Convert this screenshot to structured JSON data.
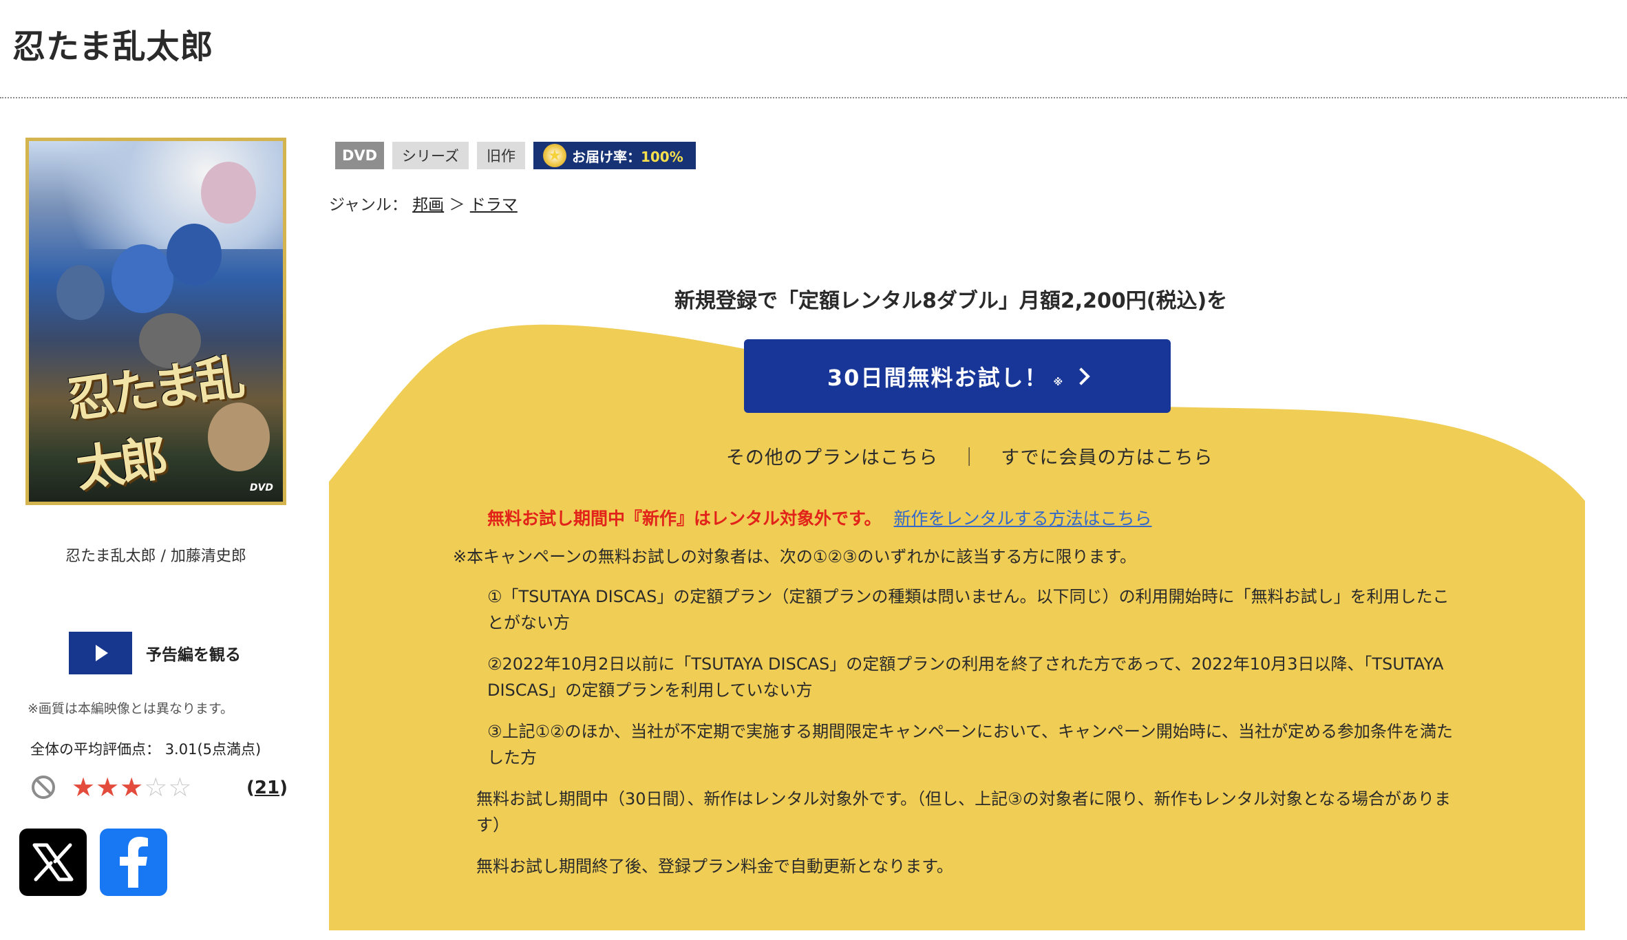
{
  "title": "忍たま乱太郎",
  "product": {
    "caption": "忍たま乱太郎 / 加藤清史郎",
    "cover_logo": "忍たま乱太郎",
    "cover_dvd": "DVD"
  },
  "trailer": {
    "label": "予告編を観る",
    "note": "※画質は本編映像とは異なります。"
  },
  "rating": {
    "label": "全体の平均評価点：",
    "value": "3.01(5点満点)",
    "stars": 3,
    "max_stars": 5,
    "count_open": "(",
    "count": "21",
    "count_close": ")"
  },
  "social": {
    "x_icon": "x-logo-icon",
    "facebook_icon": "facebook-logo-icon"
  },
  "tags": {
    "format": "DVD",
    "series": "シリーズ",
    "old": "旧作",
    "delivery_label": "お届け率：",
    "delivery_value": "100%"
  },
  "genre": {
    "label": "ジャンル：",
    "parent": "邦画",
    "separator": "＞",
    "child": "ドラマ"
  },
  "campaign": {
    "heading": "新規登録で「定額レンタル8ダブル」月額2,200円(税込)を",
    "cta_label": "30日間無料お試し！",
    "cta_mark": "※",
    "other_plans": "その他のプランはこちら",
    "separator": "｜",
    "members": "すでに会員の方はこちら",
    "warning": "無料お試し期間中『新作』はレンタル対象外です。",
    "warning_link": "新作をレンタルする方法はこちら",
    "intro": "※本キャンペーンの無料お試しの対象者は、次の①②③のいずれかに該当する方に限ります。",
    "condition_1": "①「TSUTAYA DISCAS」の定額プラン（定額プランの種類は問いません。以下同じ）の利用開始時に「無料お試し」を利用したことがない方",
    "condition_2": "②2022年10月2日以前に「TSUTAYA DISCAS」の定額プランの利用を終了された方であって、2022年10月3日以降、「TSUTAYA DISCAS」の定額プランを利用していない方",
    "condition_3": "③上記①②のほか、当社が不定期で実施する期間限定キャンペーンにおいて、キャンペーン開始時に、当社が定める参加条件を満たした方",
    "note_1": "無料お試し期間中（30日間）、新作はレンタル対象外です。（但し、上記③の対象者に限り、新作もレンタル対象となる場合があります）",
    "note_2": "無料お試し期間終了後、登録プラン料金で自動更新となります。"
  },
  "colors": {
    "campaign_bg": "#f0cd55",
    "cta_bg": "#183697",
    "warning_red": "#e2231a",
    "link_blue": "#3469c9",
    "delivery_bg": "#183276"
  }
}
